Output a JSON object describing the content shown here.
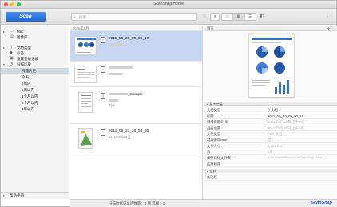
{
  "window": {
    "title": "ScanSnap Home"
  },
  "toolbar": {
    "scan_label": "Scan",
    "search_placeholder": "搜索",
    "view_modes": [
      "▭",
      "▦",
      "☰"
    ]
  },
  "sidebar": {
    "items": [
      {
        "label": "Mac",
        "icon": "computer-icon"
      },
      {
        "label": "图像库",
        "icon": "library-icon"
      },
      {
        "label": "文档类型",
        "icon": "document-type-icon"
      },
      {
        "label": "标签",
        "icon": "tag-icon"
      },
      {
        "label": "设置登录记录",
        "icon": "profile-icon"
      },
      {
        "label": "扫描历史",
        "icon": "history-icon"
      },
      {
        "label": "扫描历史",
        "icon": ""
      },
      {
        "label": "今天",
        "icon": ""
      },
      {
        "label": "2周内",
        "icon": ""
      },
      {
        "label": "1周以内",
        "icon": ""
      },
      {
        "label": "1个月以内",
        "icon": ""
      },
      {
        "label": "3个月以内",
        "icon": ""
      },
      {
        "label": "1年以内",
        "icon": ""
      }
    ],
    "bottom": "帮助手册"
  },
  "list": {
    "header": "2025年6月",
    "docs": [
      {
        "name": "2011_05_20_09_00_19",
        "sub": ""
      },
      {
        "name": "",
        "sub": ""
      },
      {
        "name": "_Sample",
        "sub": "刘永"
      },
      {
        "name": "2011_05_23_26_59_30",
        "sub": "2011年5月20日"
      }
    ]
  },
  "detail": {
    "header": "预览",
    "section_basic": "基本信息",
    "properties": [
      {
        "key": "文档类型",
        "value": "文档"
      },
      {
        "key": "标题",
        "value": "2011_05_20_09_00_19"
      },
      {
        "key": "扫描日期/时间",
        "value": "2011年5月20日 上午9点"
      },
      {
        "key": "品质设置",
        "value": "2011年5月20日 上午9点"
      },
      {
        "key": "文件类型",
        "value": "PDF 文档"
      },
      {
        "key": "可搜索的PDF",
        "value": "是"
      },
      {
        "key": "文件大小",
        "value": "1,202 KB"
      },
      {
        "key": "页",
        "value": "1页"
      },
      {
        "key": "保存目标文件夹",
        "value": "/Users/admin/Documents/ScanSnap Home"
      },
      {
        "key": "应用程序",
        "value": ""
      }
    ],
    "section_other": "文档",
    "other_properties": [
      {
        "key": "备注栏",
        "value": ""
      }
    ]
  },
  "status": {
    "text": "扫描数据记录的数量：4 项 选择：1",
    "brand": "ScanSnap"
  },
  "colors": {
    "accent": "#1e64d2",
    "selection": "#c7d7f2"
  }
}
